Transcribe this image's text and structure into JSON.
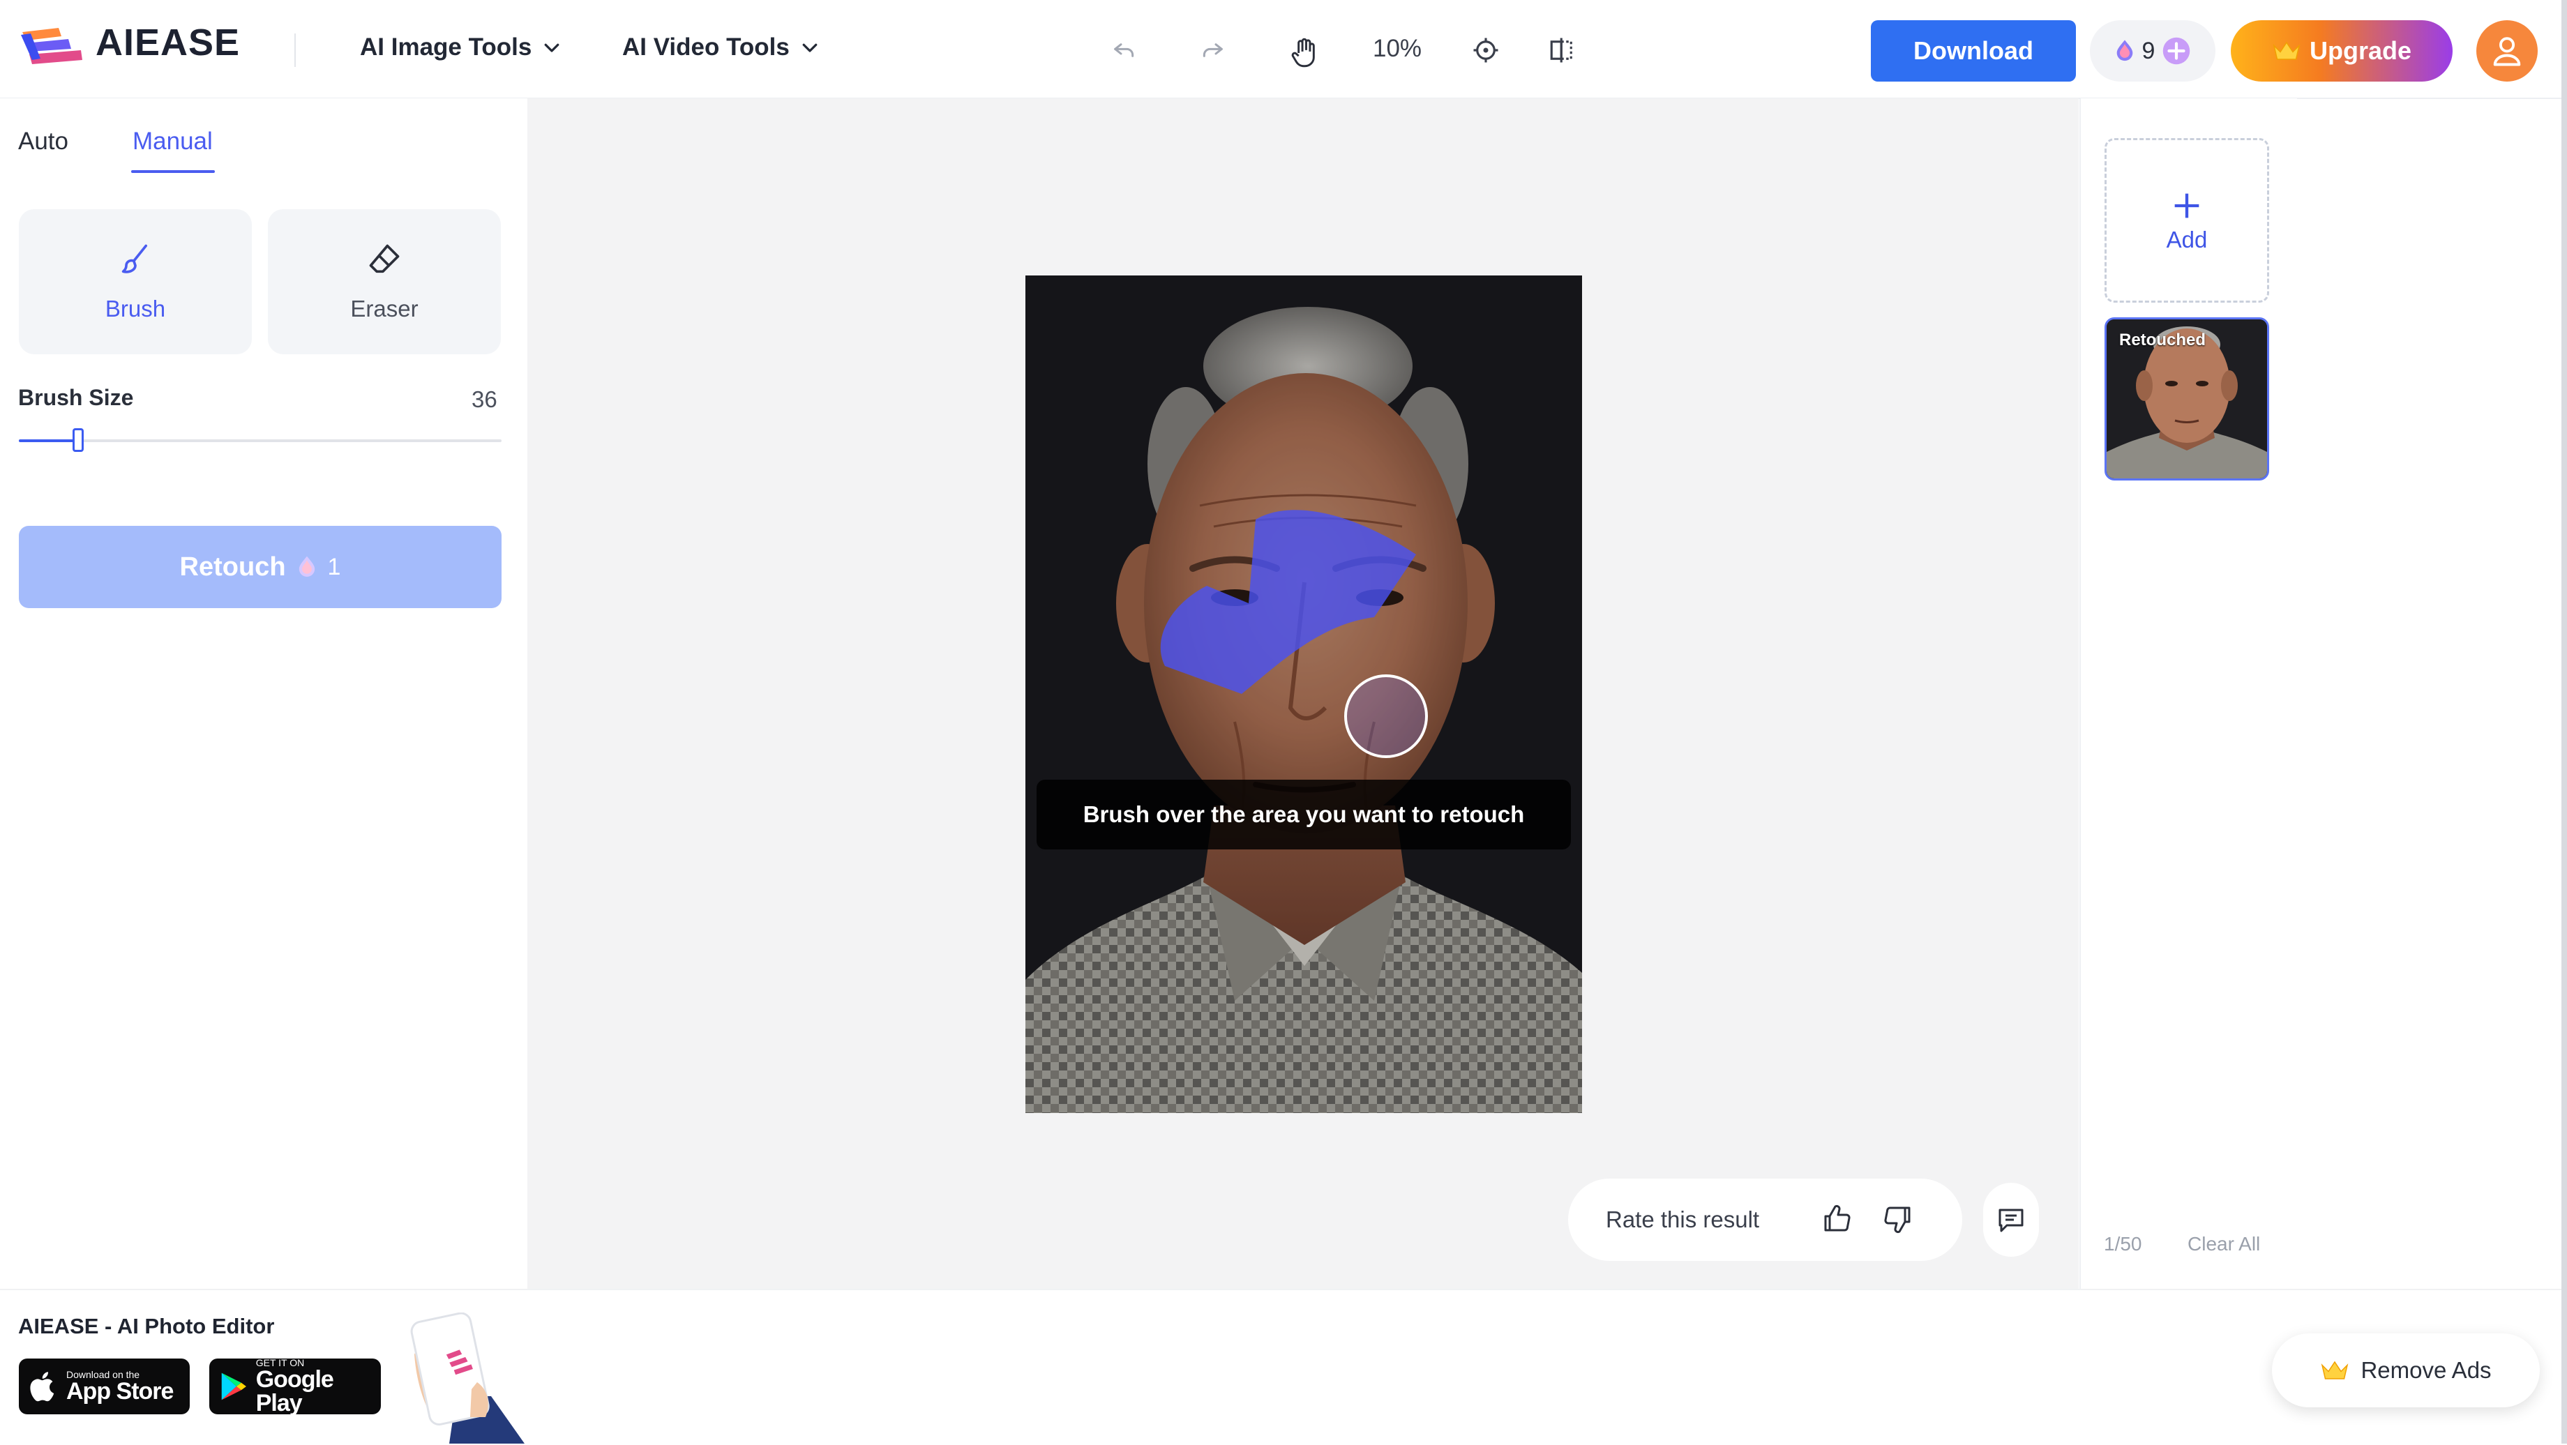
{
  "header": {
    "logo_text": "AIEASE",
    "nav": [
      {
        "label": "AI Image Tools"
      },
      {
        "label": "AI Video Tools"
      }
    ],
    "zoom_level": "10%",
    "download_label": "Download",
    "credits_count": "9",
    "upgrade_label": "Upgrade"
  },
  "left_panel": {
    "tabs": [
      {
        "label": "Auto",
        "active": false
      },
      {
        "label": "Manual",
        "active": true
      }
    ],
    "tools": [
      {
        "label": "Brush",
        "icon": "brush-icon",
        "selected": true
      },
      {
        "label": "Eraser",
        "icon": "eraser-icon",
        "selected": false
      }
    ],
    "brush_size_label": "Brush Size",
    "brush_size_value": "36",
    "retouch_label": "Retouch",
    "retouch_cost": "1"
  },
  "canvas": {
    "tooltip": "Brush over the area you want to retouch",
    "rate_label": "Rate this result"
  },
  "right_panel": {
    "add_label": "Add",
    "history_badge": "Retouched",
    "count": "1/50",
    "clear_all": "Clear All"
  },
  "footer": {
    "app_title": "AIEASE - AI Photo Editor",
    "app_store_small": "Download on the",
    "app_store_big": "App Store",
    "google_play_small": "GET IT ON",
    "google_play_big": "Google Play",
    "remove_ads_label": "Remove Ads"
  },
  "colors": {
    "accent": "#2f6ff2",
    "manual_tab": "#4a5cf0",
    "brush_mask": "#4a52f0",
    "upgrade_start": "#ffb21a",
    "upgrade_end": "#9a3de8",
    "avatar": "#f6873c"
  }
}
